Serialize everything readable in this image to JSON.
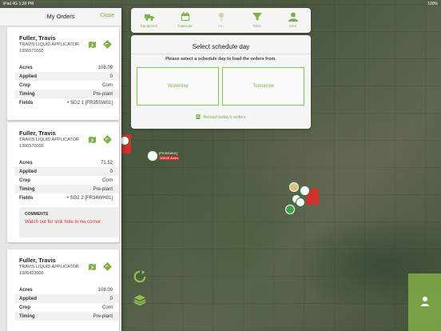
{
  "status": {
    "left": "iPad 4G 1:28 PM",
    "right": "100%"
  },
  "orders_panel": {
    "title": "My Orders",
    "close_label": "Close",
    "cards": [
      {
        "name": "Fuller, Travis",
        "company": "TRAVIS LIQUID APPLICATOR",
        "number": "1306571000",
        "rows": [
          {
            "k": "Acres",
            "v": "108.09"
          },
          {
            "k": "Applied",
            "v": "0"
          },
          {
            "k": "Crop",
            "v": "Corn"
          },
          {
            "k": "Timing",
            "v": "Pre-plant"
          },
          {
            "k": "Fields",
            "v": "• SG2 1  [FR35SW01]"
          }
        ]
      },
      {
        "name": "Fuller, Travis",
        "company": "TRAVIS LIQUID APPLICATOR",
        "number": "1306570000",
        "rows": [
          {
            "k": "Acres",
            "v": "71.52"
          },
          {
            "k": "Applied",
            "v": "0"
          },
          {
            "k": "Crop",
            "v": "Corn"
          },
          {
            "k": "Timing",
            "v": "Pre-plant"
          },
          {
            "k": "Fields",
            "v": "• SG2 2  [FR34WH01]"
          }
        ],
        "comments_title": "COMMENTS",
        "comments_body": "Watch out for sink hole in nw corner"
      },
      {
        "name": "Fuller, Travis",
        "company": "TRAVIS LIQUID APPLICATOR",
        "number": "1306423000",
        "rows": [
          {
            "k": "Acres",
            "v": "108.09"
          },
          {
            "k": "Applied",
            "v": "0"
          },
          {
            "k": "Crop",
            "v": "Corn"
          },
          {
            "k": "Timing",
            "v": "Pre-plant"
          }
        ]
      }
    ]
  },
  "toolbar": {
    "items": [
      {
        "label": "Equipment",
        "icon": "truck-icon"
      },
      {
        "label": "Calendar",
        "icon": "calendar-icon"
      },
      {
        "label": "Pin",
        "icon": "pin-icon"
      },
      {
        "label": "Filter",
        "icon": "filter-icon"
      },
      {
        "label": "User",
        "icon": "user-icon"
      }
    ]
  },
  "schedule": {
    "title": "Select schedule day",
    "message": "Please select a schedule day to load the orders from.",
    "yesterday": "Yesterday",
    "tomorrow": "Tomorrow",
    "reload": "Reload today's orders"
  },
  "map": {
    "marker_label": "[FR35SW01]",
    "marker_sub": "108.09 Acres"
  },
  "colors": {
    "accent": "#7cb342",
    "field": "#d32f2f",
    "comment": "#d32f2f"
  }
}
